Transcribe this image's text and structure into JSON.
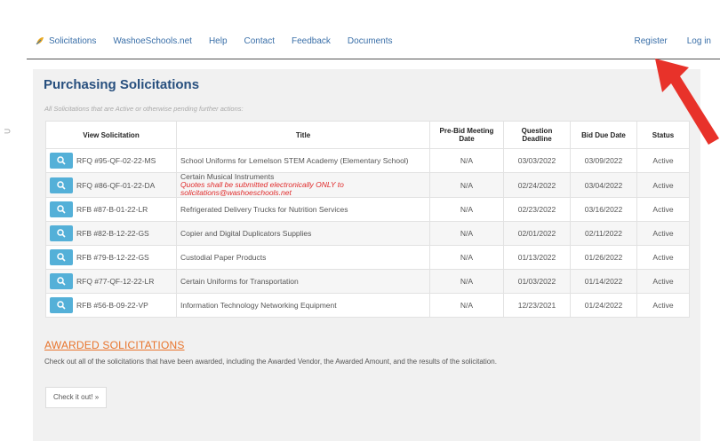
{
  "nav": {
    "brand": "Solicitations",
    "links": [
      "WashoeSchools.net",
      "Help",
      "Contact",
      "Feedback",
      "Documents"
    ],
    "register": "Register",
    "login": "Log in"
  },
  "page": {
    "title": "Purchasing Solicitations",
    "subtitle": "All Solicitations that are Active or otherwise pending further actions:"
  },
  "table": {
    "headers": {
      "view": "View Solicitation",
      "title": "Title",
      "prebid": "Pre-Bid Meeting Date",
      "question": "Question Deadline",
      "due": "Bid Due Date",
      "status": "Status"
    },
    "rows": [
      {
        "id": "RFQ #95-QF-02-22-MS",
        "title": "School Uniforms for Lemelson STEM Academy (Elementary School)",
        "note": "",
        "prebid": "N/A",
        "question": "03/03/2022",
        "due": "03/09/2022",
        "status": "Active"
      },
      {
        "id": "RFQ #86-QF-01-22-DA",
        "title": "Certain Musical Instruments",
        "note": "Quotes shall be submitted electronically ONLY to solicitations@washoeschools.net",
        "prebid": "N/A",
        "question": "02/24/2022",
        "due": "03/04/2022",
        "status": "Active"
      },
      {
        "id": "RFB #87-B-01-22-LR",
        "title": "Refrigerated Delivery Trucks for Nutrition Services",
        "note": "",
        "prebid": "N/A",
        "question": "02/23/2022",
        "due": "03/16/2022",
        "status": "Active"
      },
      {
        "id": "RFB #82-B-12-22-GS",
        "title": "Copier and Digital Duplicators Supplies",
        "note": "",
        "prebid": "N/A",
        "question": "02/01/2022",
        "due": "02/11/2022",
        "status": "Active"
      },
      {
        "id": "RFB #79-B-12-22-GS",
        "title": "Custodial Paper Products",
        "note": "",
        "prebid": "N/A",
        "question": "01/13/2022",
        "due": "01/26/2022",
        "status": "Active"
      },
      {
        "id": "RFQ #77-QF-12-22-LR",
        "title": "Certain Uniforms for Transportation",
        "note": "",
        "prebid": "N/A",
        "question": "01/03/2022",
        "due": "01/14/2022",
        "status": "Active"
      },
      {
        "id": "RFB #56-B-09-22-VP",
        "title": "Information Technology Networking Equipment",
        "note": "",
        "prebid": "N/A",
        "question": "12/23/2021",
        "due": "01/24/2022",
        "status": "Active"
      }
    ]
  },
  "awarded": {
    "heading": "AWARDED SOLICITATIONS",
    "description": "Check out all of the solicitations that have been awarded, including the Awarded Vendor, the Awarded Amount, and the results of the solicitation.",
    "button": "Check it out! »"
  },
  "colors": {
    "accent": "#274f7e",
    "link": "#3a6fa8",
    "button": "#54b0d8",
    "orange": "#e8742c",
    "arrow": "#e8322a"
  },
  "icons": {
    "search": "search-icon",
    "logo": "leaf-logo-icon",
    "arrow": "red-arrow-icon"
  }
}
